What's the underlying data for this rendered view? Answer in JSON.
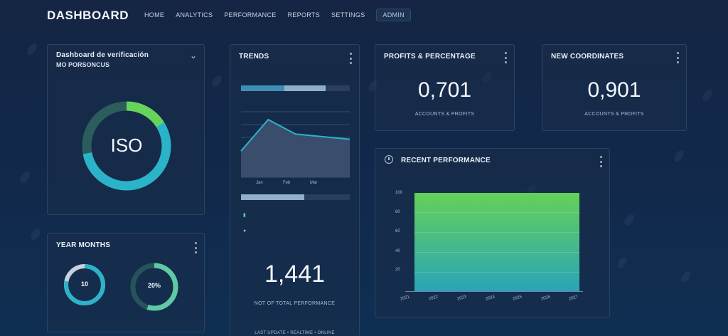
{
  "brand": "DASHBOARD",
  "nav": [
    {
      "label": "HOME"
    },
    {
      "label": "ANALYTICS"
    },
    {
      "label": "PERFORMANCE"
    },
    {
      "label": "REPORTS"
    },
    {
      "label": "SETTINGS"
    },
    {
      "label": "ADMIN"
    }
  ],
  "donut_card": {
    "title": "Dashboard de verificación",
    "subtitle": "MO PORSONCUS",
    "center": "ISO",
    "progress": 0.72
  },
  "small_card": {
    "title": "YEAR MONTHS",
    "ring1": {
      "label": "10",
      "progress": 0.78
    },
    "ring2": {
      "label": "20%",
      "progress": 0.55
    }
  },
  "trend_card": {
    "title": "TRENDS",
    "bar1": {
      "a": 0.4,
      "b": 0.38
    },
    "bar2": {
      "a": 0.58,
      "b": 0.0
    },
    "x_labels": [
      "Jan",
      "Feb",
      "Mar"
    ],
    "legend": [
      "▮",
      "●"
    ],
    "big": "1,441",
    "caption": "NOT OF TOTAL PERFORMANCE",
    "footer": "LAST UPDATE  •  REALTIME  •  ONLINE"
  },
  "stat1": {
    "title": "PROFITS & PERCENTAGE",
    "value": "0,701",
    "caption": "ACCOUNTS & PROFITS"
  },
  "stat2": {
    "title": "NEW COORDINATES",
    "value": "0,901",
    "caption": "ACCOUNTS & PROFITS"
  },
  "bar_card": {
    "title": "RECENT PERFORMANCE",
    "y_ticks": [
      "100",
      "80",
      "60",
      "40",
      "20"
    ],
    "x_ticks": [
      "2021",
      "2022",
      "2023",
      "2024",
      "2025",
      "2026",
      "2027"
    ]
  },
  "chart_data": {
    "type": "line",
    "title": "TRENDS",
    "x": [
      "Jan",
      "Feb",
      "Mar"
    ],
    "series": [
      {
        "values": [
          40,
          88,
          66,
          62,
          58
        ]
      }
    ],
    "ylim": [
      0,
      100
    ]
  },
  "colors": {
    "teal": "#2bb3c9",
    "green": "#66d45a",
    "dark_ring": "#2a5a5a"
  }
}
